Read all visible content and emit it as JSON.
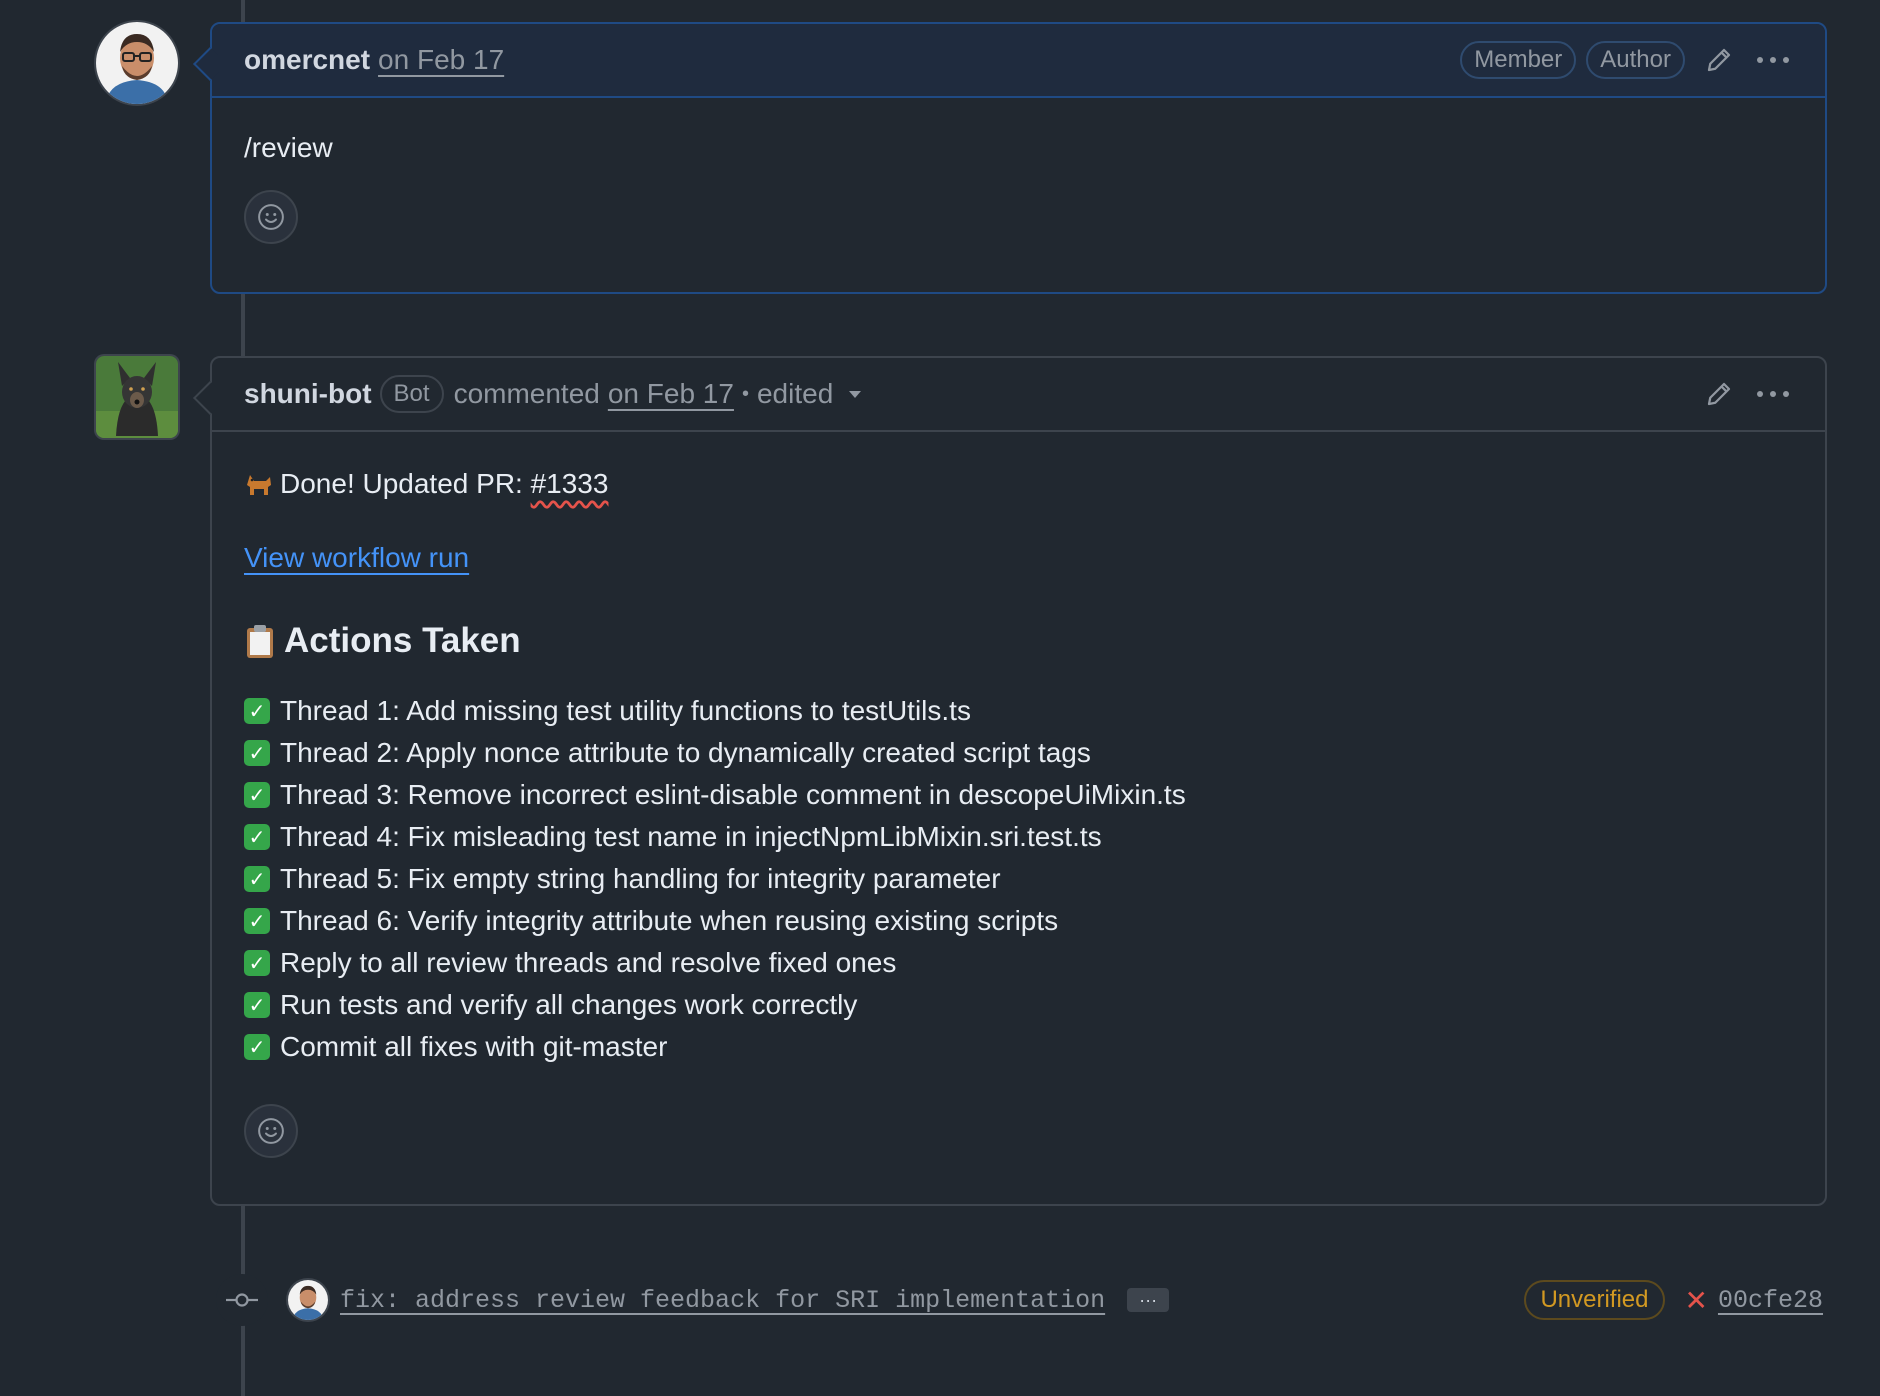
{
  "comments": [
    {
      "author": "omercnet",
      "date": "on Feb 17",
      "badges": [
        "Member",
        "Author"
      ],
      "body": "/review"
    },
    {
      "author": "shuni-bot",
      "bot_badge": "Bot",
      "verb": "commented",
      "date": "on Feb 17",
      "separator": "•",
      "edited": "edited",
      "done_prefix": "Done! Updated PR: ",
      "pr_ref": "#1333",
      "workflow_link": "View workflow run",
      "actions_heading": "Actions Taken",
      "actions": [
        "Thread 1: Add missing test utility functions to testUtils.ts",
        "Thread 2: Apply nonce attribute to dynamically created script tags",
        "Thread 3: Remove incorrect eslint-disable comment in descopeUiMixin.ts",
        "Thread 4: Fix misleading test name in injectNpmLibMixin.sri.test.ts",
        "Thread 5: Fix empty string handling for integrity parameter",
        "Thread 6: Verify integrity attribute when reusing existing scripts",
        "Reply to all review threads and resolve fixed ones",
        "Run tests and verify all changes work correctly",
        "Commit all fixes with git-master"
      ]
    }
  ],
  "commit": {
    "message": "fix: address review feedback for SRI implementation",
    "more": "···",
    "status": "Unverified",
    "sha": "00cfe28"
  },
  "icons": {
    "edit": "pencil-icon",
    "more": "kebab-horizontal-icon",
    "reaction": "smiley-icon",
    "commit": "git-commit-icon",
    "check": "check-box-icon",
    "clipboard": "clipboard-icon",
    "dog": "dog-icon",
    "dropdown": "triangle-down-icon",
    "fail": "x-icon"
  },
  "colors": {
    "background": "#212830",
    "border": "#3d444d",
    "highlight_header": "#1f2b3e",
    "highlight_border": "#1f4a84",
    "link": "#4493f8",
    "check": "#35a64a",
    "warning": "#d29922",
    "danger": "#e5534b"
  }
}
